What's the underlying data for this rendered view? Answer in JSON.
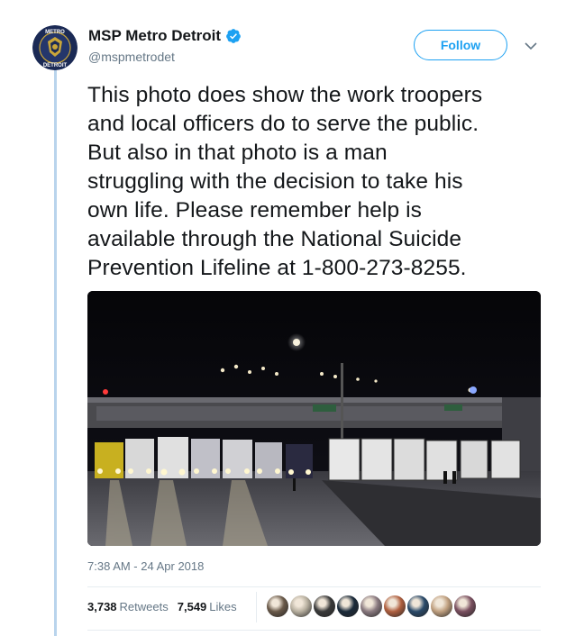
{
  "author": {
    "name": "MSP Metro Detroit",
    "handle": "@mspmetrodet",
    "verified": true,
    "avatar_text_top": "METRO",
    "avatar_text_bottom": "DETROIT"
  },
  "follow_label": "Follow",
  "tweet_lines": [
    "This photo does show the work troopers",
    "and local officers do to serve the public.",
    "But also in that photo is a man",
    "struggling with the decision to take his",
    "own life. Please remember help is",
    "available through the National Suicide",
    "Prevention Lifeline at 1-800-273-8255."
  ],
  "timestamp": "7:38 AM - 24 Apr 2018",
  "stats": {
    "retweets_count": "3,738",
    "retweets_label": "Retweets",
    "likes_count": "7,549",
    "likes_label": "Likes"
  },
  "colors": {
    "accent": "#1da1f2",
    "thread_line": "#b9d4ec",
    "muted": "#657786",
    "text": "#14171a"
  },
  "icons": {
    "verified": "verified-badge-icon",
    "more": "chevron-down-icon"
  },
  "liker_colors": [
    "#6a5a4a",
    "#b8b0a0",
    "#3a3a3a",
    "#1a2a3a",
    "#8a7a80",
    "#b06040",
    "#2a4a6a",
    "#c0a080",
    "#7a5060"
  ]
}
